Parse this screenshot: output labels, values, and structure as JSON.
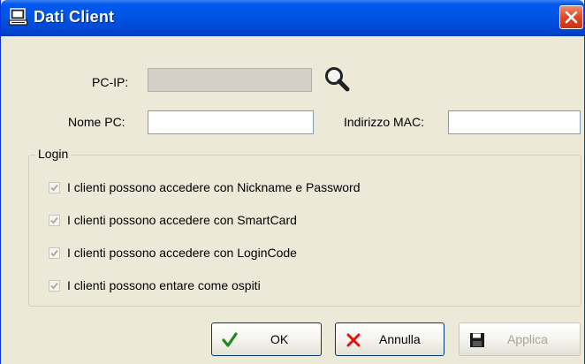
{
  "window": {
    "title": "Dati Client",
    "icon": "computer-icon",
    "close_icon": "close-icon"
  },
  "form": {
    "pcip_label": "PC-IP:",
    "pcip_value": "",
    "search_icon": "magnifier-icon",
    "nomepc_label": "Nome PC:",
    "nomepc_value": "",
    "mac_label": "Indirizzo MAC:",
    "mac_value": ""
  },
  "login": {
    "legend": "Login",
    "options": [
      {
        "label": "I clienti possono accedere con Nickname e Password",
        "checked": true,
        "enabled": false
      },
      {
        "label": "I clienti possono accedere con SmartCard",
        "checked": true,
        "enabled": false
      },
      {
        "label": "I clienti possono accedere con LoginCode",
        "checked": true,
        "enabled": false
      },
      {
        "label": "I clienti possono entare come ospiti",
        "checked": true,
        "enabled": false
      }
    ]
  },
  "buttons": {
    "ok": {
      "label": "OK",
      "icon": "checkmark-icon",
      "color": "#1e8a1e"
    },
    "cancel": {
      "label": "Annulla",
      "icon": "x-icon",
      "color": "#e01010"
    },
    "apply": {
      "label": "Applica",
      "icon": "floppy-disk-icon",
      "enabled": false
    }
  }
}
